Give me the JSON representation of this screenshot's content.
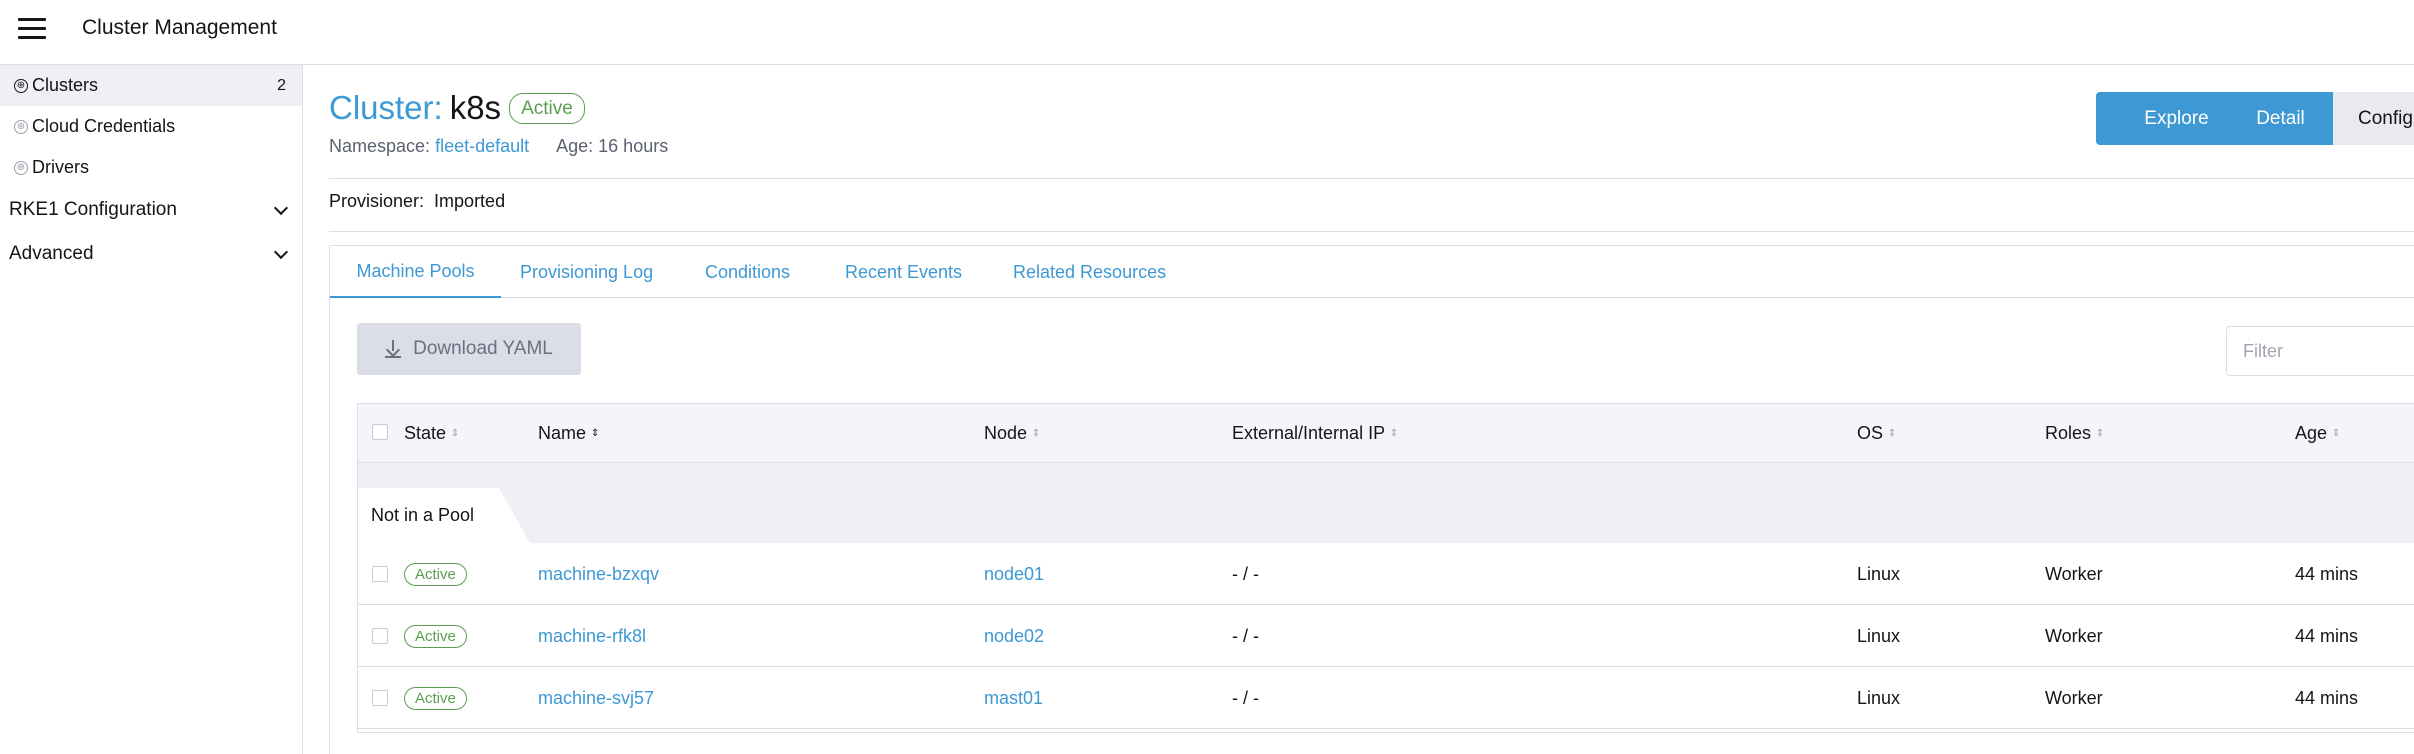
{
  "header": {
    "app_title": "Cluster Management",
    "menu_icon": "hamburger-menu-icon"
  },
  "sidebar": {
    "items": [
      {
        "label": "Clusters",
        "count": "2",
        "icon": "globe-icon"
      },
      {
        "label": "Cloud Credentials",
        "icon": "globe-icon"
      },
      {
        "label": "Drivers",
        "icon": "globe-icon"
      }
    ],
    "groups": [
      {
        "label": "RKE1 Configuration"
      },
      {
        "label": "Advanced"
      }
    ]
  },
  "cluster": {
    "title_prefix": "Cluster:",
    "name": "k8s",
    "status": "Active",
    "namespace_label": "Namespace:",
    "namespace_value": "fleet-default",
    "age_text": "Age: 16 hours",
    "provisioner_label": "Provisioner:",
    "provisioner_value": "Imported"
  },
  "actions": {
    "explore": "Explore",
    "detail": "Detail",
    "config": "Config"
  },
  "tabs": [
    "Machine Pools",
    "Provisioning Log",
    "Conditions",
    "Recent Events",
    "Related Resources"
  ],
  "toolbar": {
    "download_label": "Download YAML",
    "filter_placeholder": "Filter"
  },
  "table": {
    "columns": [
      "State",
      "Name",
      "Node",
      "External/Internal IP",
      "OS",
      "Roles",
      "Age"
    ],
    "group_label": "Not in a Pool",
    "rows": [
      {
        "state": "Active",
        "name": "machine-bzxqv",
        "node": "node01",
        "ip": "- / -",
        "os": "Linux",
        "roles": "Worker",
        "age": "44 mins"
      },
      {
        "state": "Active",
        "name": "machine-rfk8l",
        "node": "node02",
        "ip": "- / -",
        "os": "Linux",
        "roles": "Worker",
        "age": "44 mins"
      },
      {
        "state": "Active",
        "name": "machine-svj57",
        "node": "mast01",
        "ip": "- / -",
        "os": "Linux",
        "roles": "Worker",
        "age": "44 mins"
      }
    ]
  },
  "colors": {
    "accent": "#3d98d3",
    "active_green": "#5a9f4f"
  }
}
